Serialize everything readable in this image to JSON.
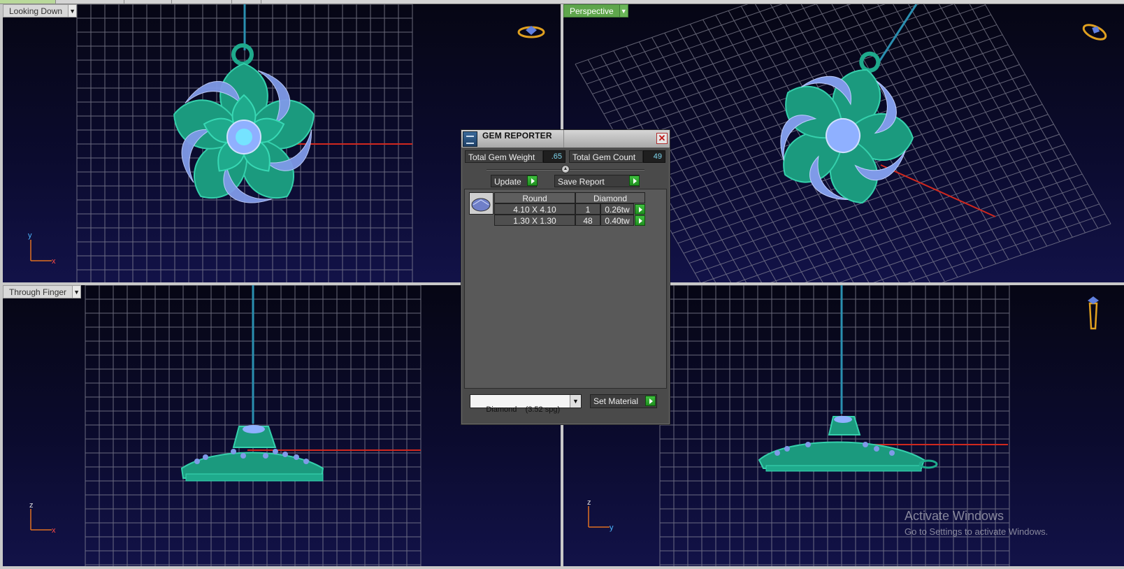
{
  "viewports": {
    "top_left": {
      "label": "Looking Down",
      "axes": [
        "y",
        "x"
      ]
    },
    "top_right": {
      "label": "Perspective"
    },
    "bottom_left": {
      "label": "Through Finger",
      "axes": [
        "z",
        "x"
      ]
    },
    "bottom_right": {
      "axes": [
        "z",
        "y"
      ]
    }
  },
  "gem_reporter": {
    "title": "GEM REPORTER",
    "close_label": "✕",
    "total_gem_weight_label": "Total Gem Weight",
    "total_gem_weight_value": ".65",
    "total_gem_count_label": "Total Gem Count",
    "total_gem_count_value": "49",
    "update_label": "Update",
    "save_report_label": "Save Report",
    "table": {
      "headers": [
        "Round",
        "Diamond"
      ],
      "rows": [
        {
          "size": "4.10 X 4.10",
          "count": "1",
          "weight": "0.26tw"
        },
        {
          "size": "1.30 X 1.30",
          "count": "48",
          "weight": "0.40tw"
        }
      ]
    },
    "material_select": "Diamond    (3.52 spg)",
    "set_material_label": "Set Material"
  },
  "watermark": {
    "line1": "Activate Windows",
    "line2": "Go to Settings to activate Windows."
  },
  "colors": {
    "metal": "#1faa8c",
    "gem": "#7f9ae8",
    "grid": "#8a8a9a",
    "axis_red": "#d0281e",
    "chain": "#2a8fb0",
    "label_green": "#5fa64c",
    "button_green": "#2faa2f"
  },
  "icons": [
    "ring-orientation-icon",
    "ring-perspective-icon",
    "ring-side-icon",
    "close-icon",
    "gem-thumbnail-icon",
    "play-arrow-icon",
    "dropdown-arrow-icon",
    "slider-knob-icon"
  ]
}
